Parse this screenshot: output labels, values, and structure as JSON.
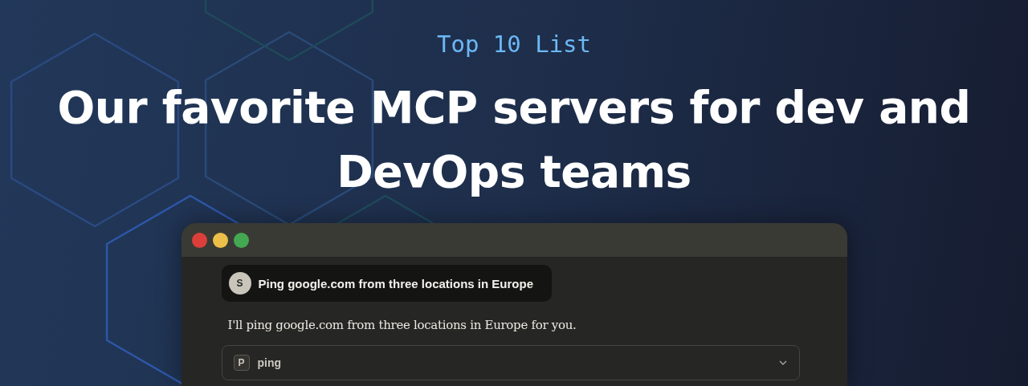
{
  "eyebrow": "Top 10 List",
  "title": "Our favorite MCP servers for dev and DevOps teams",
  "chat": {
    "user_message": {
      "avatar": "S",
      "text": "Ping google.com from three locations in Europe"
    },
    "reply": "I'll ping google.com from three locations in Europe for you.",
    "tool": {
      "badge": "P",
      "name": "ping",
      "expanded": false
    }
  }
}
